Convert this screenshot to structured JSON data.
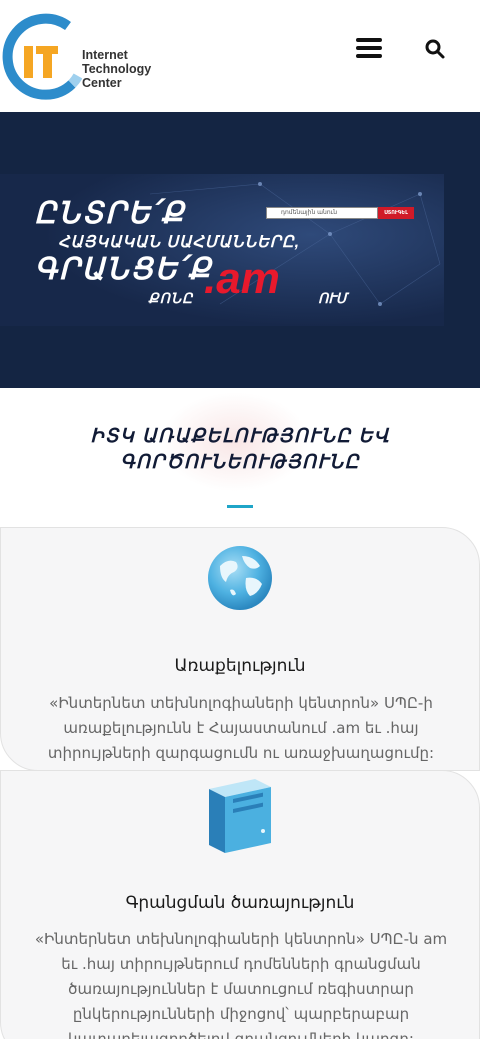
{
  "header": {
    "logo_mark": "IT",
    "logo_line1": "Internet",
    "logo_line2": "Technology",
    "logo_line3": "Center",
    "menu_icon": "hamburger-icon",
    "search_icon": "search-icon"
  },
  "banner": {
    "line1": "ԸՆՏՐԵ՛Ք",
    "line2": "ՀԱՅԿԱԿԱՆ ՍԱՀՄԱՆՆԵՐԸ,",
    "line3": "ԳՐԱՆՑԵ՛Ք",
    "line4": "ՔՈՆԸ",
    "domain": ".am",
    "suffix": "ՈՒՄ",
    "search_placeholder": "դոմենային անուն",
    "search_button": "ՍՏՈՒԳԵԼ"
  },
  "section": {
    "title_line1": "ԻՏԿ ԱՌԱՔԵԼՈՒԹՅՈՒՆԸ ԵՎ",
    "title_line2": "ԳՈՐԾՈՒՆԵՈՒԹՅՈՒՆԸ",
    "accent": "#1fa5c8"
  },
  "cards": [
    {
      "icon": "globe-icon",
      "title": "Առաքելություն",
      "text_line1": "«Ինտերնետ տեխնոլոգիաների կենտրոն» ՍՊԸ-ի",
      "text_line2": "առաքելությունն է Հայաստանում .am եւ .հայ",
      "text_line3": "տիրույթների զարգացումն ու առաջխաղացումը:"
    },
    {
      "icon": "server-icon",
      "title": "Գրանցման ծառայություն",
      "text_line1": "«Ինտերնետ տեխնոլոգիաների կենտրոն» ՍՊԸ-ն am",
      "text_line2": "եւ .հայ տիրույթներում դոմենների գրանցման",
      "text_line3": "ծառայություններ է մատուցում ռեգիստրար",
      "text_line4": "ընկերությունների միջոցով՝ պարբերաբար",
      "text_line5": "կատարելագործելով գրանցումների կարգը:"
    }
  ],
  "colors": {
    "hero_bg": "#142543",
    "brand_red": "#e8192c",
    "logo_blue": "#2d8ccb",
    "logo_orange": "#f5a623"
  }
}
